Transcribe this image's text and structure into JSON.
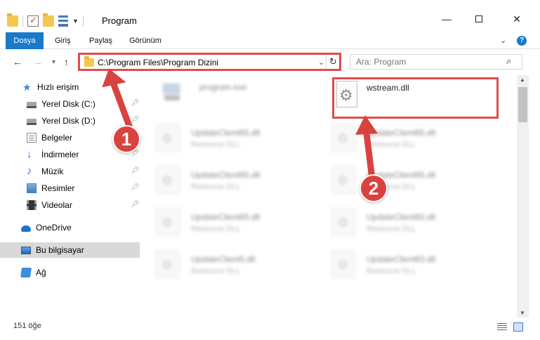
{
  "window": {
    "title": "Program",
    "minimize_glyph": "—",
    "close_glyph": "✕"
  },
  "ribbon": {
    "tabs": [
      {
        "label": "Dosya",
        "active": true
      },
      {
        "label": "Giriş"
      },
      {
        "label": "Paylaş"
      },
      {
        "label": "Görünüm"
      }
    ],
    "help_glyph": "?"
  },
  "address": {
    "path": "C:\\Program Files\\Program Dizini",
    "search_placeholder": "Ara: Program"
  },
  "sidebar": {
    "items": [
      {
        "label": "Hızlı erişim",
        "icon": "star-icon"
      },
      {
        "label": "Yerel Disk (C:)",
        "icon": "drive-icon",
        "pinned": true
      },
      {
        "label": "Yerel Disk (D:)",
        "icon": "drive-icon",
        "pinned": true
      },
      {
        "label": "Belgeler",
        "icon": "documents-icon",
        "pinned": true
      },
      {
        "label": "İndirmeler",
        "icon": "download-icon",
        "pinned": true
      },
      {
        "label": "Müzik",
        "icon": "music-icon",
        "pinned": true
      },
      {
        "label": "Resimler",
        "icon": "pictures-icon",
        "pinned": true
      },
      {
        "label": "Videolar",
        "icon": "video-icon",
        "pinned": true
      },
      {
        "label": "OneDrive",
        "icon": "cloud-icon"
      },
      {
        "label": "Bu bilgisayar",
        "icon": "computer-icon",
        "selected": true
      },
      {
        "label": "Ağ",
        "icon": "network-icon"
      }
    ]
  },
  "files": [
    {
      "name": "program.exe",
      "type": ""
    },
    {
      "name": "wstream.dll",
      "type": "",
      "highlighted": true
    },
    {
      "name": "UpdateClient65.dll",
      "type": "Resource DLL"
    },
    {
      "name": "UpdateClient65.dll",
      "type": "Resource DLL"
    },
    {
      "name": "UpdateClient65.dll",
      "type": "Resource DLL"
    },
    {
      "name": "UpdateClient65.dll",
      "type": "Resource DLL"
    },
    {
      "name": "UpdateClient65.dll",
      "type": "Resource DLL"
    },
    {
      "name": "UpdateClient65.dll",
      "type": "Resource DLL"
    },
    {
      "name": "UpdateClient5.dll",
      "type": "Resource DLL"
    },
    {
      "name": "UpdateClient63.dll",
      "type": "Resource DLL"
    }
  ],
  "status": {
    "item_count": "151 öğe"
  },
  "annotations": {
    "step1": "1",
    "step2": "2",
    "color": "#d9423f"
  }
}
